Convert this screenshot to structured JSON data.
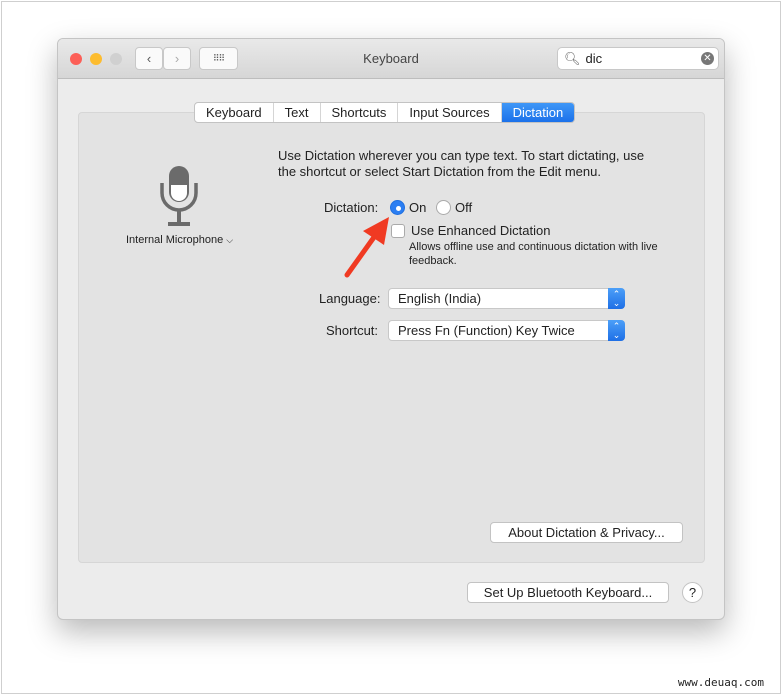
{
  "window": {
    "title": "Keyboard",
    "traffic_light_colors": [
      "#fc5f57",
      "#fdbc2e",
      "#d0d0d0"
    ]
  },
  "search": {
    "value": "dic"
  },
  "tabs": [
    {
      "label": "Keyboard"
    },
    {
      "label": "Text"
    },
    {
      "label": "Shortcuts"
    },
    {
      "label": "Input Sources"
    },
    {
      "label": "Dictation",
      "active": true
    }
  ],
  "mic": {
    "label": "Internal Microphone"
  },
  "description": "Use Dictation wherever you can type text. To start dictating, use the shortcut or select Start Dictation from the Edit menu.",
  "dictation": {
    "label": "Dictation:",
    "on_label": "On",
    "off_label": "Off",
    "selected": "On"
  },
  "enhanced": {
    "label": "Use Enhanced Dictation",
    "checked": false,
    "note": "Allows offline use and continuous dictation with live feedback."
  },
  "language": {
    "label": "Language:",
    "value": "English (India)"
  },
  "shortcut": {
    "label": "Shortcut:",
    "value": "Press Fn (Function) Key Twice"
  },
  "about_button": "About Dictation & Privacy...",
  "bluetooth_button": "Set Up Bluetooth Keyboard...",
  "help_button": "?",
  "annotation": {
    "color": "#f03a22"
  },
  "watermark": "www.deuaq.com"
}
